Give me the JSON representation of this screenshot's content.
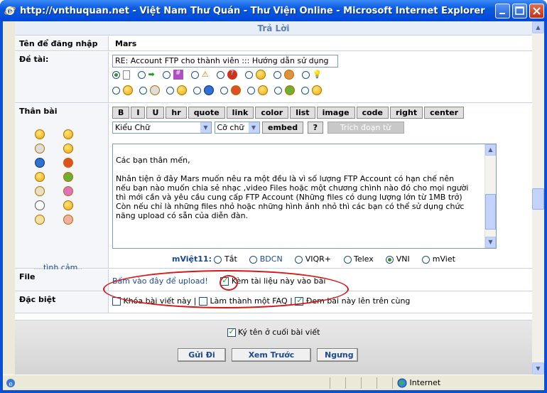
{
  "window": {
    "title": "http://vnthuquan.net - Việt Nam Thư Quán - Thư Viện Online - Microsoft Internet Explorer"
  },
  "form": {
    "header": "Trả Lời",
    "username_label": "Tên để đăng nhập",
    "username_value": "Mars",
    "subject_label": "Đề tài:",
    "subject_value": "RE: Account FTP cho thành viên ::: Hướng dẫn sử dụng",
    "body_label": "Thân bài",
    "more_emoticons": "... tình cảm..",
    "toolbar_buttons": [
      "B",
      "I",
      "U",
      "hr",
      "quote",
      "link",
      "color",
      "list",
      "image",
      "code",
      "right",
      "center"
    ],
    "font_select": "Kiểu Chữ",
    "size_select": "Cỡ chữ",
    "embed_button": "embed",
    "help_button": "?",
    "quote_selection_button": "Trích đoạn từ",
    "body_text": [
      "Các bạn thân mến,",
      "",
      "Nhân tiện ở đây Mars muốn nêu ra một đều là vì số lượng FTP Account có hạn chế nên",
      "nếu bạn nào muốn chia sẻ nhạc ,video Files hoặc một chương chình nào đó cho mọi người",
      "thì mới cần và yêu cầu cung cấp FTP Account (Những files có dung lượng lớn từ 1MB trở)",
      "Còn nếu chỉ là những files nhỏ hoặc những hình ảnh nhỏ thì các bạn có thể sử dụng chức",
      "năng upload có sẵn của diễn đàn."
    ],
    "typing_label": "mViệt11:",
    "typing_modes": [
      {
        "label": "Tắt",
        "selected": false
      },
      {
        "label": "BDCN",
        "selected": false
      },
      {
        "label": "VIQR+",
        "selected": false
      },
      {
        "label": "Telex",
        "selected": false
      },
      {
        "label": "VNI",
        "selected": true
      },
      {
        "label": "mViet",
        "selected": false
      }
    ],
    "file_label": "File",
    "upload_link": "Bấm vào đây để upload!",
    "attach_label": "Kèm tài liệu này vào bài",
    "attach_checked": true,
    "special_label": "Đặc biệt",
    "lock_label": "Khóa bài viết này",
    "faq_label": "Làm thành một FAQ",
    "pin_label": "Đem bài này lên trên cùng",
    "signature_label": "Ký tên ở cuối bài viết",
    "submit_button": "Gửi Đi",
    "preview_button": "Xem Trước",
    "stop_button": "Ngưng"
  },
  "status": {
    "zone": "Internet"
  },
  "colors": {
    "titlebar": "#0048d8",
    "annotation": "#d81818",
    "link": "#1c4a90"
  }
}
